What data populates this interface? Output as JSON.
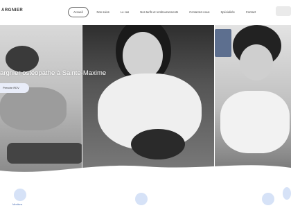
{
  "brand": {
    "partial_name": "ARGNIER"
  },
  "nav": {
    "items": [
      {
        "label": "Accueil",
        "active": true
      },
      {
        "label": "Nos soins"
      },
      {
        "label": "Le cas"
      },
      {
        "label": "Nos tarifs et remboursements"
      },
      {
        "label": "Contactez-nous"
      },
      {
        "label": "Spécialités"
      },
      {
        "label": "Contact"
      }
    ]
  },
  "hero": {
    "title": "argnier ostéopathe à Sainte-Maxime",
    "cta_label": "Prendre RDV"
  },
  "footer": {
    "link": "Mentions"
  },
  "colors": {
    "accent": "#d6e2f7",
    "cta_bg": "#e9edf9",
    "link": "#4b6fb5"
  }
}
